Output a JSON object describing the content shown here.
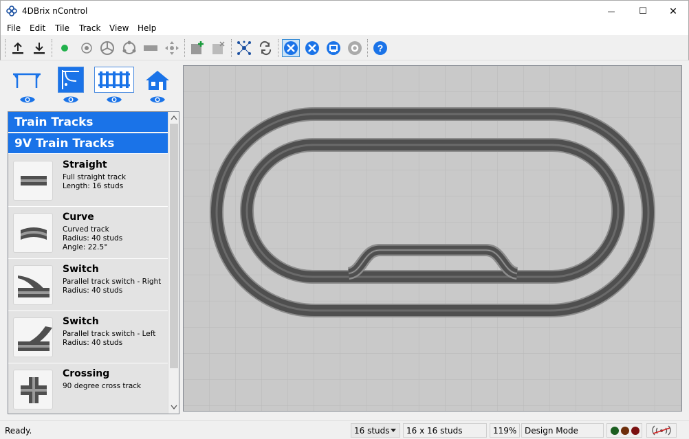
{
  "window": {
    "title": "4DBrix nControl",
    "minimize_glyph": "—",
    "maximize_glyph": "☐",
    "close_glyph": "✕"
  },
  "menu": [
    "File",
    "Edit",
    "Tile",
    "Track",
    "View",
    "Help"
  ],
  "toolbar": {
    "icons": [
      "upload-icon",
      "download-icon",
      "green-dot-icon",
      "sensor-icon",
      "wheel-icon",
      "circle-icon",
      "brick-icon",
      "move-icon",
      "add-tile-icon",
      "remove-tile-icon",
      "network-icon",
      "loop-icon",
      "design-tools-icon",
      "wrench-icon",
      "display-icon",
      "settings-icon",
      "help-icon"
    ],
    "active": "design-tools-icon"
  },
  "categories": [
    {
      "name": "table",
      "selected": false
    },
    {
      "name": "signals",
      "selected": false
    },
    {
      "name": "tracks",
      "selected": true
    },
    {
      "name": "buildings",
      "selected": false
    }
  ],
  "palette": {
    "header1": "Train Tracks",
    "header2": "9V Train Tracks",
    "items": [
      {
        "name": "Straight",
        "desc": "Full straight track\nLength: 16 studs"
      },
      {
        "name": "Curve",
        "desc": "Curved track\nRadius: 40 studs\nAngle: 22.5°"
      },
      {
        "name": "Switch",
        "desc": "Parallel track switch - Right\nRadius: 40 studs"
      },
      {
        "name": "Switch",
        "desc": "Parallel track switch - Left\nRadius: 40 studs"
      },
      {
        "name": "Crossing",
        "desc": "90 degree cross track"
      }
    ]
  },
  "status": {
    "text": "Ready.",
    "grid": "16 studs",
    "tile_size": "16 x 16 studs",
    "zoom": "119%",
    "mode": "Design Mode",
    "lights": [
      "#1b5e20",
      "#6d2e0b",
      "#7a1010"
    ],
    "colors": {
      "accent": "#1a73e8",
      "canvas": "#c9c9c9",
      "track": "#4f4f4f"
    }
  }
}
